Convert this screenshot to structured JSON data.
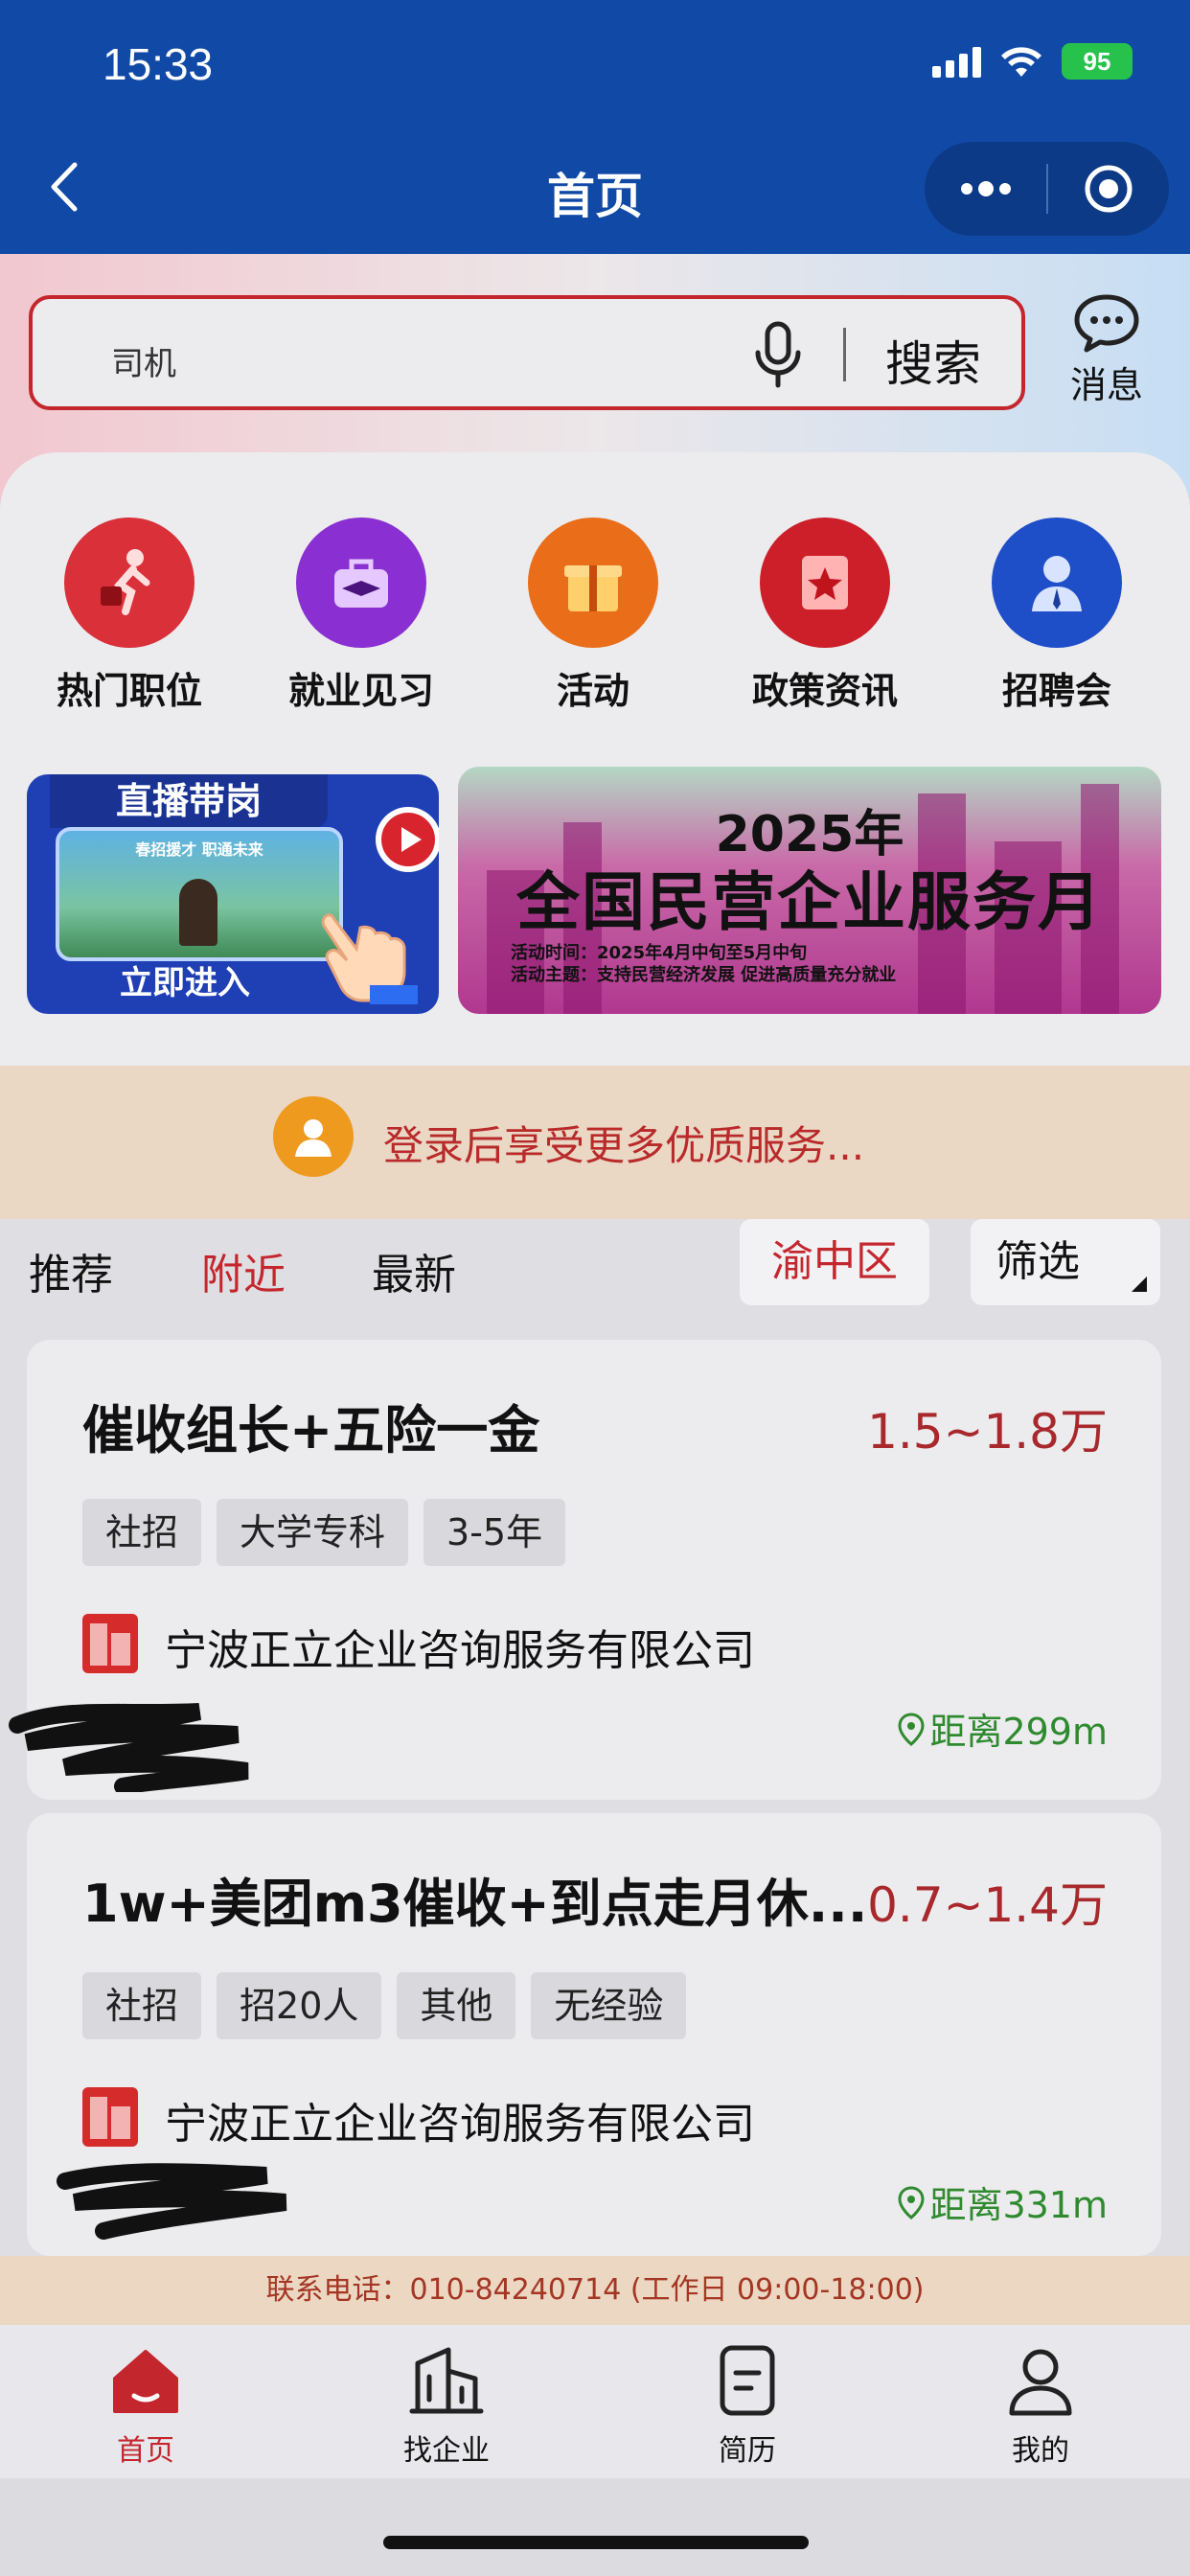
{
  "status_bar": {
    "time": "15:33",
    "battery": "95"
  },
  "nav": {
    "title": "首页"
  },
  "search": {
    "value": "司机",
    "button": "搜索",
    "message_label": "消息"
  },
  "categories": [
    {
      "label": "热门职位",
      "color": "#d9303a",
      "icon": "running-person-icon"
    },
    {
      "label": "就业见习",
      "color": "#8a2fd1",
      "icon": "graduation-bag-icon"
    },
    {
      "label": "活动",
      "color": "#ea6d1a",
      "icon": "gift-icon"
    },
    {
      "label": "政策资讯",
      "color": "#cc1f29",
      "icon": "star-document-icon"
    },
    {
      "label": "招聘会",
      "color": "#1f4ec9",
      "icon": "interview-person-icon"
    }
  ],
  "banners": {
    "live": {
      "title": "直播带岗",
      "screen_text": "春招援才 职通未来",
      "enter": "立即进入"
    },
    "month": {
      "year": "2025年",
      "title": "全国民营企业服务月",
      "line1": "活动时间：2025年4月中旬至5月中旬",
      "line2": "活动主题：支持民营经济发展 促进高质量充分就业"
    }
  },
  "login_prompt": "登录后享受更多优质服务...",
  "tabs": [
    {
      "label": "推荐"
    },
    {
      "label": "附近"
    },
    {
      "label": "最新"
    }
  ],
  "active_tab": "附近",
  "district": "渝中区",
  "filter": "筛选",
  "jobs": [
    {
      "title": "催收组长+五险一金",
      "salary": "1.5~1.8万",
      "tags": [
        "社招",
        "大学专科",
        "3-5年"
      ],
      "company": "宁波正立企业咨询服务有限公司",
      "distance": "距离299m"
    },
    {
      "title": "1w+美团m3催收+到点走月休...",
      "salary": "0.7~1.4万",
      "tags": [
        "社招",
        "招20人",
        "其他",
        "无经验"
      ],
      "company": "宁波正立企业咨询服务有限公司",
      "distance": "距离331m"
    }
  ],
  "contact": "联系电话：010-84240714 (工作日 09:00-18:00)",
  "bottom_nav": [
    {
      "label": "首页",
      "icon": "home-icon"
    },
    {
      "label": "找企业",
      "icon": "building-icon"
    },
    {
      "label": "简历",
      "icon": "resume-icon"
    },
    {
      "label": "我的",
      "icon": "user-icon"
    }
  ],
  "colors": {
    "brand_blue": "#114aa6",
    "accent_red": "#c4262e",
    "distance_green": "#2f8a2f"
  }
}
